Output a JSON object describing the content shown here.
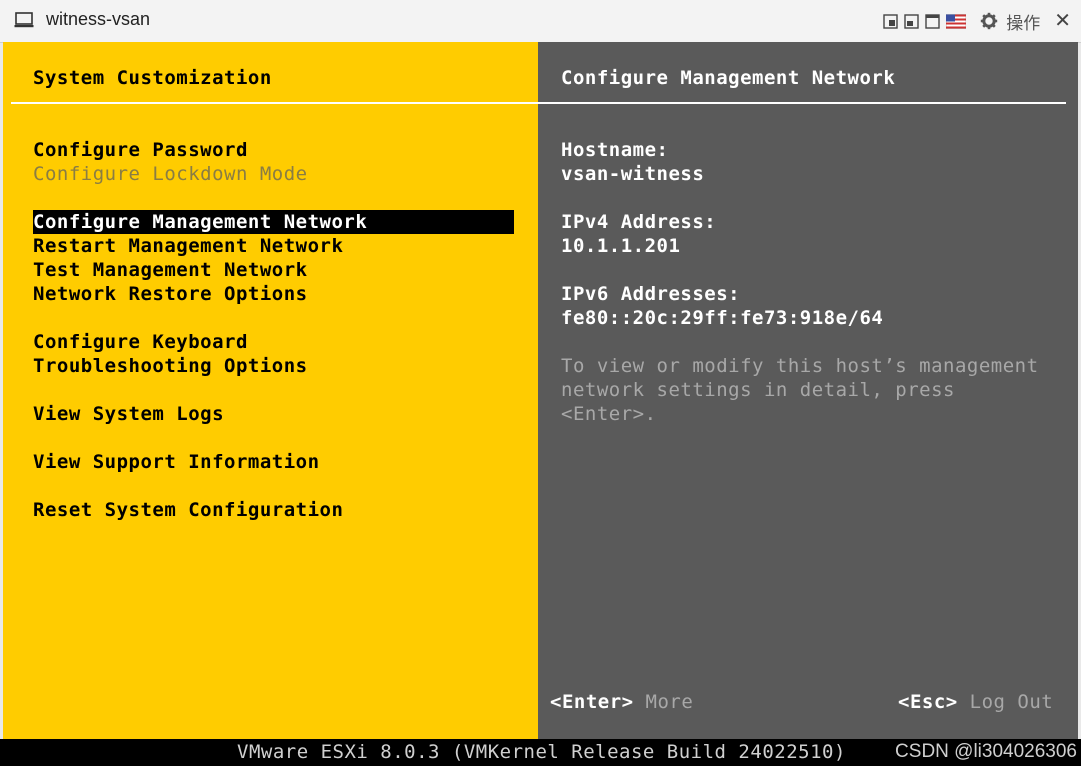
{
  "window": {
    "title": "witness-vsan",
    "ops_label": "操作",
    "icons": [
      "vm-console-icon",
      "fit-window-icon",
      "restore-icon",
      "fullscreen-icon",
      "keyboard-layout-flag-icon",
      "gear-icon",
      "close-icon"
    ],
    "close_glyph": "✕"
  },
  "left": {
    "title": "System Customization",
    "menu": [
      {
        "label": "Configure Password",
        "state": "enabled"
      },
      {
        "label": "Configure Lockdown Mode",
        "state": "disabled"
      },
      {
        "label": "Configure Management Network",
        "state": "selected"
      },
      {
        "label": "Restart Management Network",
        "state": "enabled"
      },
      {
        "label": "Test Management Network",
        "state": "enabled"
      },
      {
        "label": "Network Restore Options",
        "state": "enabled"
      },
      {
        "label": "Configure Keyboard",
        "state": "enabled"
      },
      {
        "label": "Troubleshooting Options",
        "state": "enabled"
      },
      {
        "label": "View System Logs",
        "state": "enabled"
      },
      {
        "label": "View Support Information",
        "state": "enabled"
      },
      {
        "label": "Reset System Configuration",
        "state": "enabled"
      }
    ]
  },
  "right": {
    "title": "Configure Management Network",
    "hostname_label": "Hostname:",
    "hostname_value": "vsan-witness",
    "ipv4_label": "IPv4 Address:",
    "ipv4_value": "10.1.1.201",
    "ipv6_label": "IPv6 Addresses:",
    "ipv6_value": "fe80::20c:29ff:fe73:918e/64",
    "note_lines": [
      "To view or modify this host’s management",
      "network settings in detail, press",
      "<Enter>."
    ]
  },
  "footer": {
    "enter_key": "<Enter>",
    "enter_action": "More",
    "esc_key": "<Esc>",
    "esc_action": "Log Out"
  },
  "status": {
    "build": "VMware ESXi 8.0.3 (VMKernel Release Build 24022510)",
    "watermark": "CSDN @li304026306"
  },
  "colors": {
    "menu_background": "#ffcc00",
    "info_background": "#5a5a5a",
    "selected_background": "#000000"
  }
}
